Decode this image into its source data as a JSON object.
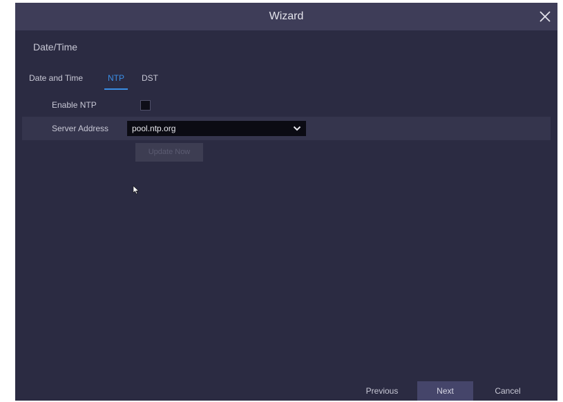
{
  "window": {
    "title": "Wizard"
  },
  "section": {
    "title": "Date/Time"
  },
  "tabs": [
    {
      "label": "Date and Time",
      "active": false
    },
    {
      "label": "NTP",
      "active": true
    },
    {
      "label": "DST",
      "active": false
    }
  ],
  "form": {
    "enable_ntp": {
      "label": "Enable NTP",
      "checked": true
    },
    "server_address": {
      "label": "Server Address",
      "value": "pool.ntp.org"
    },
    "update_now_label": "Update Now"
  },
  "footer": {
    "previous_label": "Previous",
    "next_label": "Next",
    "cancel_label": "Cancel"
  },
  "icons": {
    "close": "close-icon",
    "chevron": "chevron-down-icon",
    "cursor": "mouse-pointer-icon"
  },
  "colors": {
    "accent": "#3a8ee6",
    "background": "#2b2b42",
    "titlebar": "#3e3d58"
  }
}
